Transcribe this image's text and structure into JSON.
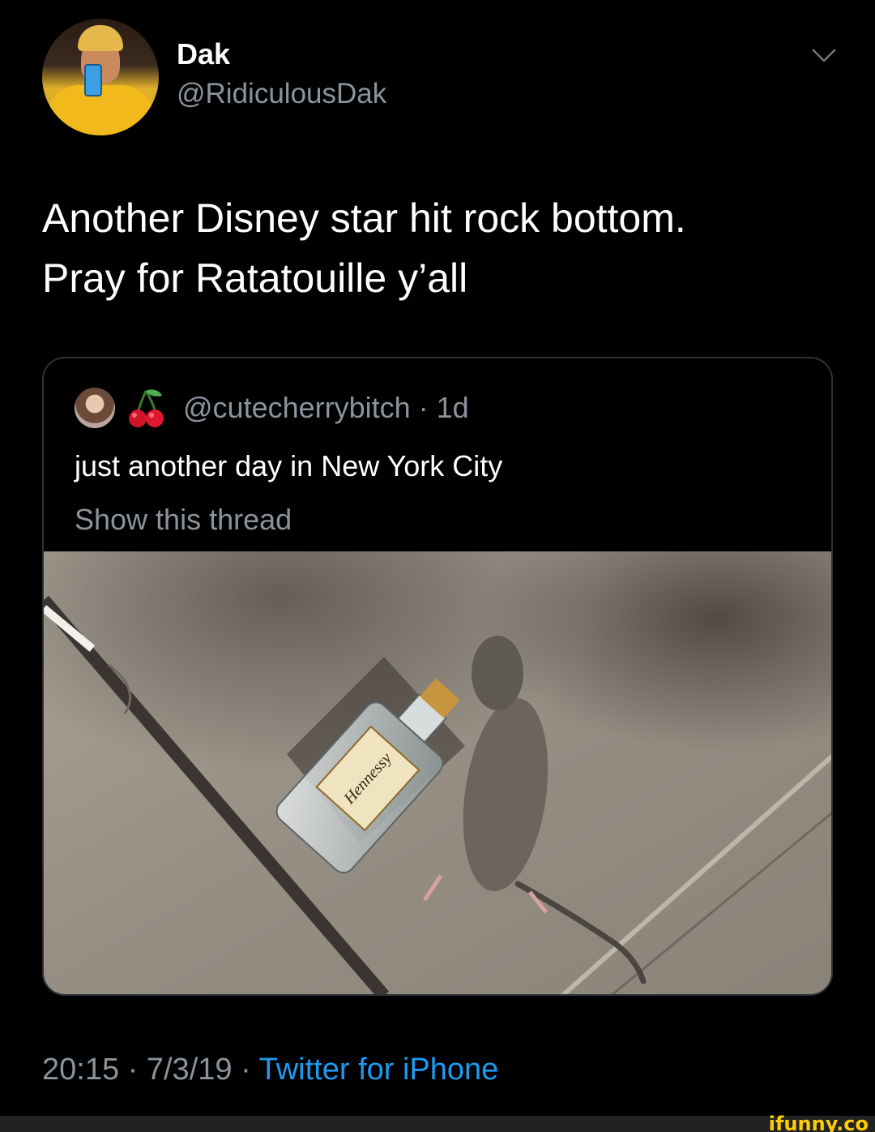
{
  "tweet": {
    "author_name": "Dak",
    "author_handle": "@RidiculousDak",
    "text_lines": [
      "Another Disney star hit rock bottom.",
      "Pray for Ratatouille y’all"
    ],
    "timestamp": "20:15 · 7/3/19 · ",
    "source": "Twitter for iPhone"
  },
  "quoted_tweet": {
    "handle_line": "@cutecherrybitch · 1d",
    "text": "just another day in New York City",
    "show_thread": "Show this thread",
    "bottle_label": "Hennessy"
  },
  "icons": {
    "menu": "chevron-down-icon",
    "emoji": "cherry-icon"
  },
  "colors": {
    "background": "#000000",
    "secondary_text": "#8b949c",
    "link": "#1d9bf0",
    "watermark": "#ffcc00"
  },
  "watermark": "ifunny.co"
}
